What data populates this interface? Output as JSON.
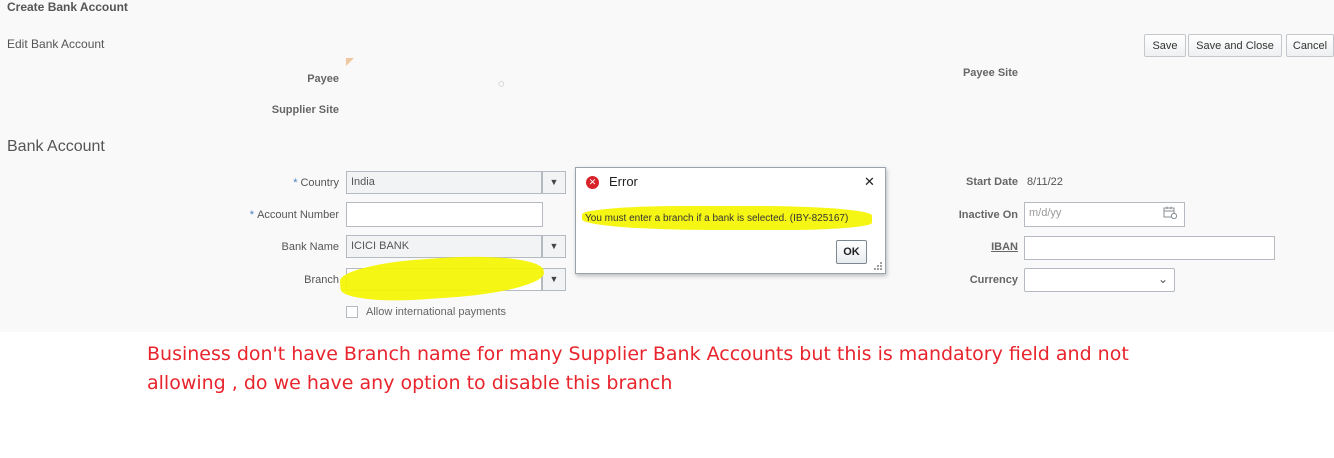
{
  "page": {
    "title": "Create Bank Account",
    "subtitle": "Edit Bank Account",
    "section_title": "Bank Account"
  },
  "toolbar": {
    "save_label": "Save",
    "save_close_label": "Save and Close",
    "cancel_label": "Cancel"
  },
  "header_fields": {
    "payee_label": "Payee",
    "supplier_site_label": "Supplier Site",
    "payee_site_label": "Payee Site"
  },
  "form": {
    "required_marker": "*",
    "country_label": "Country",
    "country_value": "India",
    "account_number_label": "Account Number",
    "account_number_value": "",
    "bank_name_label": "Bank Name",
    "bank_name_value": "ICICI BANK",
    "branch_label": "Branch",
    "branch_value": "",
    "allow_intl_label": "Allow international payments",
    "allow_intl_checked": false,
    "start_date_label": "Start Date",
    "start_date_value": "8/11/22",
    "inactive_on_label": "Inactive On",
    "inactive_on_placeholder": "m/d/yy",
    "iban_label": "IBAN",
    "iban_value": "",
    "currency_label": "Currency",
    "currency_value": ""
  },
  "dialog": {
    "title": "Error",
    "message": "You must enter a branch if a bank is selected. (IBY-825167)",
    "ok_label": "OK"
  },
  "annotation": {
    "line1": "Business don't have Branch name for many Supplier Bank Accounts but this is mandatory field and not",
    "line2": "allowing , do we have any option to disable this branch",
    "color": "#e8242c",
    "highlight_color": "#f5f500"
  }
}
